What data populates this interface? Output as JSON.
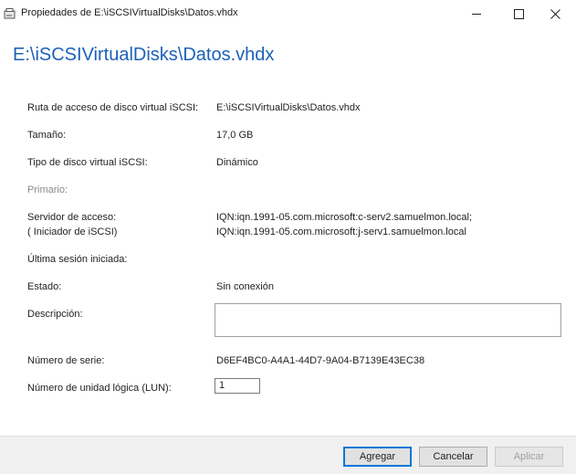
{
  "window": {
    "title": "Propiedades de E:\\iSCSIVirtualDisks\\Datos.vhdx",
    "minimize_glyph": "—",
    "maximize_glyph": "☐",
    "close_glyph": "✕"
  },
  "heading": "E:\\iSCSIVirtualDisks\\Datos.vhdx",
  "fields": {
    "path_label": "Ruta de acceso de disco virtual iSCSI:",
    "path_value": "E:\\iSCSIVirtualDisks\\Datos.vhdx",
    "size_label": "Tamaño:",
    "size_value": "17,0 GB",
    "type_label": "Tipo de disco virtual iSCSI:",
    "type_value": "Dinámico",
    "primary_label": "Primario:",
    "server_label": "Servidor de acceso:",
    "server_sublabel": "( Iniciador de iSCSI)",
    "server_values": [
      "IQN:iqn.1991-05.com.microsoft:c-serv2.samuelmon.local;",
      "IQN:iqn.1991-05.com.microsoft:j-serv1.samuelmon.local"
    ],
    "last_session_label": "Última sesión iniciada:",
    "state_label": "Estado:",
    "state_value": "Sin conexión",
    "description_label": "Descripción:",
    "description_value": "",
    "serial_label": "Número de serie:",
    "serial_value": "D6EF4BC0-A4A1-44D7-9A04-B7139E43EC38",
    "lun_label": "Número de unidad lógica (LUN):",
    "lun_value": "1"
  },
  "buttons": {
    "add": "Agregar",
    "cancel": "Cancelar",
    "apply": "Aplicar"
  }
}
